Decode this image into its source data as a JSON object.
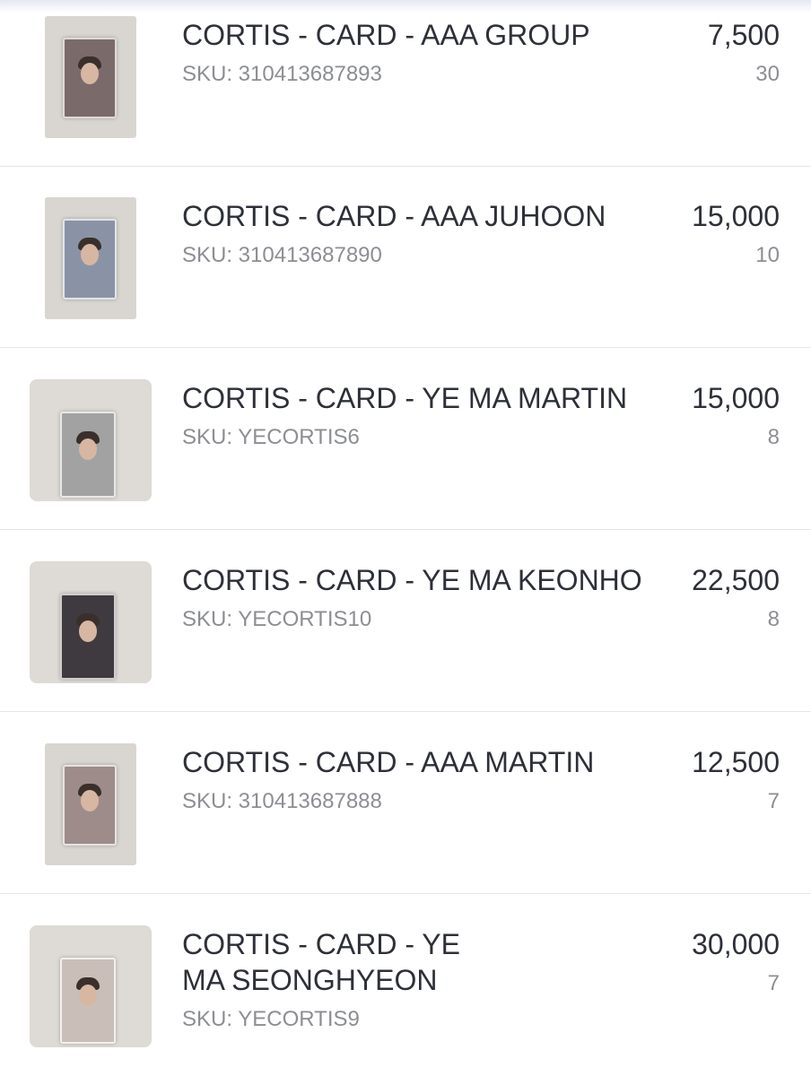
{
  "products": [
    {
      "name": "CORTIS - CARD - AAA GROUP",
      "sku": "SKU: 310413687893",
      "price": "7,500",
      "qty": "30",
      "card_color": "#7b6a6a"
    },
    {
      "name": "CORTIS - CARD - AAA JUHOON",
      "sku": "SKU: 310413687890",
      "price": "15,000",
      "qty": "10",
      "card_color": "#8a93a6"
    },
    {
      "name": "CORTIS - CARD - YE MA MARTIN",
      "sku": "SKU: YECORTIS6",
      "price": "15,000",
      "qty": "8",
      "card_color": "#a2a2a2"
    },
    {
      "name": "CORTIS - CARD - YE MA KEONHO",
      "sku": "SKU: YECORTIS10",
      "price": "22,500",
      "qty": "8",
      "card_color": "#3f3a40"
    },
    {
      "name": "CORTIS - CARD - AAA MARTIN",
      "sku": "SKU: 310413687888",
      "price": "12,500",
      "qty": "7",
      "card_color": "#9d8c8a"
    },
    {
      "name": "CORTIS - CARD - YE\nMA SEONGHYEON",
      "sku": "SKU: YECORTIS9",
      "price": "30,000",
      "qty": "7",
      "card_color": "#c9bfb8"
    }
  ]
}
